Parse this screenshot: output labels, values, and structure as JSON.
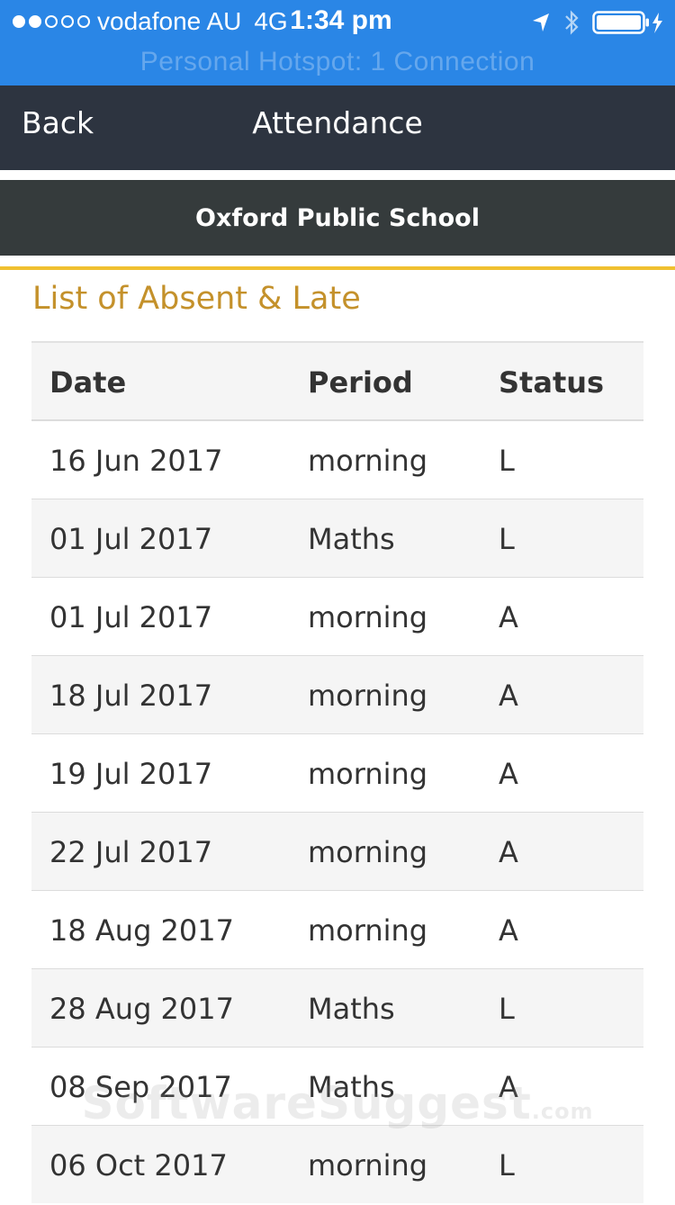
{
  "status_bar": {
    "signal_dots_filled": 2,
    "signal_dots_total": 5,
    "carrier": "vodafone AU",
    "network": "4G",
    "time": "1:34 pm",
    "hotspot": "Personal Hotspot: 1 Connection",
    "icons": [
      "location-arrow-icon",
      "bluetooth-icon",
      "battery-charging-icon"
    ]
  },
  "nav": {
    "back_label": "Back",
    "title": "Attendance"
  },
  "school": {
    "name": "Oxford Public School"
  },
  "section": {
    "title": "List of Absent & Late"
  },
  "table": {
    "headers": {
      "date": "Date",
      "period": "Period",
      "status": "Status"
    },
    "rows": [
      {
        "date": "16 Jun 2017",
        "period": "morning",
        "status": "L"
      },
      {
        "date": "01 Jul 2017",
        "period": "Maths",
        "status": "L"
      },
      {
        "date": "01 Jul 2017",
        "period": "morning",
        "status": "A"
      },
      {
        "date": "18 Jul 2017",
        "period": "morning",
        "status": "A"
      },
      {
        "date": "19 Jul 2017",
        "period": "morning",
        "status": "A"
      },
      {
        "date": "22 Jul 2017",
        "period": "morning",
        "status": "A"
      },
      {
        "date": "18 Aug 2017",
        "period": "morning",
        "status": "A"
      },
      {
        "date": "28 Aug 2017",
        "period": "Maths",
        "status": "L"
      },
      {
        "date": "08 Sep 2017",
        "period": "Maths",
        "status": "A"
      },
      {
        "date": "06 Oct 2017",
        "period": "morning",
        "status": "L"
      }
    ]
  },
  "watermark": {
    "brand": "SoftwareSuggest",
    "suffix": ".com"
  },
  "colors": {
    "status_bar": "#2a86e6",
    "navbar": "#2d3440",
    "school_bar": "#353b3c",
    "accent_rule": "#f0c030",
    "section_title": "#c4912b",
    "row_shade": "#f5f5f5"
  }
}
